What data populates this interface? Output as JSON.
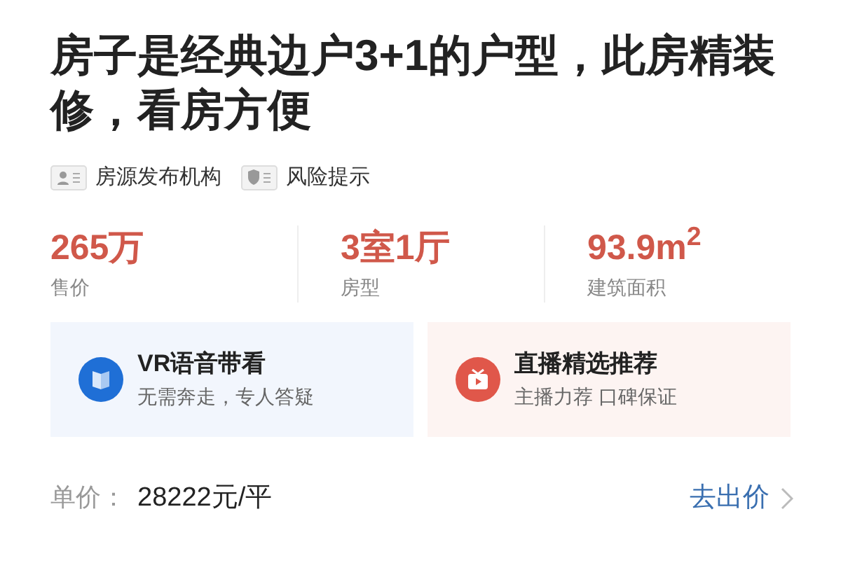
{
  "title": "房子是经典边户3+1的户型，此房精装修，看房方便",
  "tags": [
    {
      "kind": "agency",
      "label": "房源发布机构"
    },
    {
      "kind": "risk",
      "label": "风险提示"
    }
  ],
  "stats": [
    {
      "value": "265万",
      "label": "售价"
    },
    {
      "value": "3室1厅",
      "label": "房型"
    },
    {
      "value": "93.9m$^{2}$",
      "label": "建筑面积"
    }
  ],
  "cards": [
    {
      "kind": "vr",
      "title": "VR语音带看",
      "subtitle": "无需奔走，专人答疑"
    },
    {
      "kind": "live",
      "title": "直播精选推荐",
      "subtitle": "主播力荐 口碑保证"
    }
  ],
  "unit_price": {
    "label": "单价：",
    "value": "28222元/平",
    "action": "去出价"
  }
}
